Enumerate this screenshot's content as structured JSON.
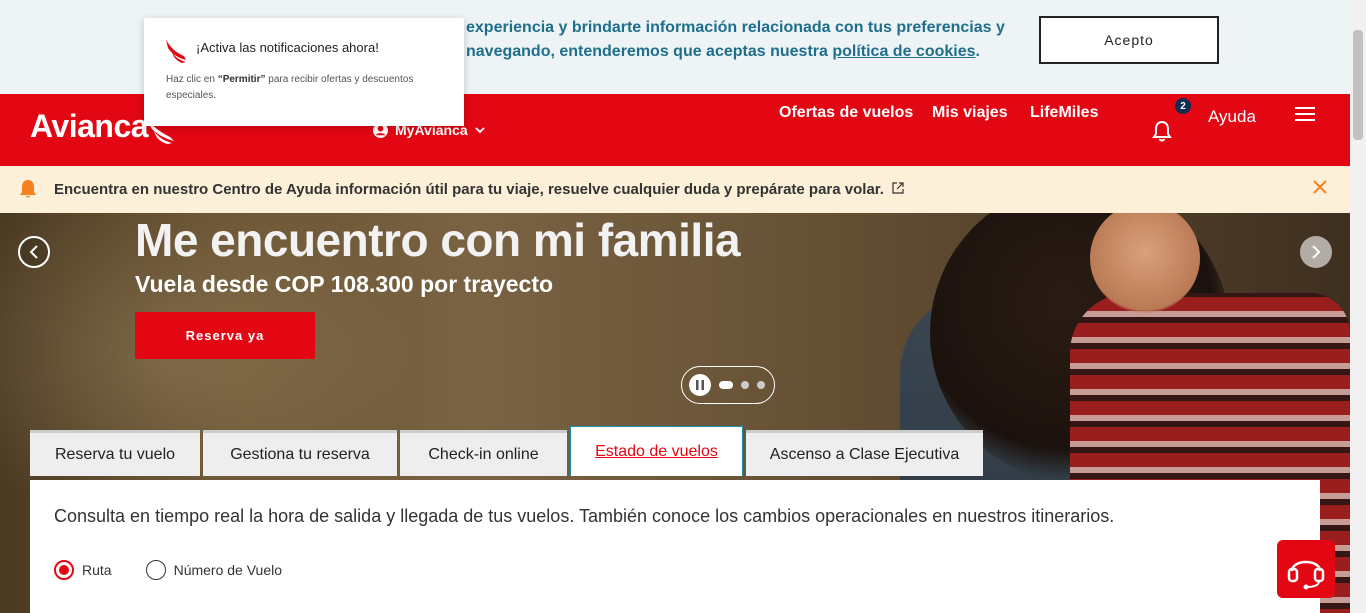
{
  "cookie": {
    "line1": "experiencia y brindarte información relacionada con tus preferencias y",
    "line2_pre": "navegando, entenderemos que aceptas nuestra ",
    "link": "política de cookies",
    "line2_post": ".",
    "accept_label": "Acepto"
  },
  "notification": {
    "title": "¡Activa las notificaciones ahora!",
    "body_pre": "Haz clic en ",
    "body_bold": "“Permitir”",
    "body_post": " para recibir ofertas y descuentos especiales."
  },
  "header": {
    "logo": "Avianca",
    "myavianca": "MyAvianca",
    "nav": [
      "Ofertas de vuelos",
      "Mis viajes",
      "LifeMiles"
    ],
    "notif_count": "2",
    "ayuda": "Ayuda"
  },
  "info": {
    "text": "Encuentra en nuestro Centro de Ayuda información útil para tu viaje, resuelve cualquier duda y prepárate para volar."
  },
  "hero": {
    "title": "Me encuentro con mi familia",
    "subtitle": "Vuela desde COP 108.300 por trayecto",
    "cta": "Reserva ya",
    "slide_count": 3,
    "active_slide": 1
  },
  "tabs": [
    {
      "label": "Reserva tu vuelo",
      "active": false
    },
    {
      "label": "Gestiona tu reserva",
      "active": false
    },
    {
      "label": "Check-in online",
      "active": false
    },
    {
      "label": "Estado de vuelos",
      "active": true
    },
    {
      "label": "Ascenso a Clase Ejecutiva",
      "active": false
    }
  ],
  "panel": {
    "description": "Consulta en tiempo real la hora de salida y llegada de tus vuelos. También conoce los cambios operacionales en nuestros itinerarios.",
    "options": [
      {
        "label": "Ruta",
        "checked": true
      },
      {
        "label": "Número de Vuelo",
        "checked": false
      }
    ]
  },
  "colors": {
    "brand_red": "#e30613",
    "link_blue": "#1f6e8c",
    "info_bg": "#fdf0d8",
    "alert_orange": "#f5821f"
  }
}
